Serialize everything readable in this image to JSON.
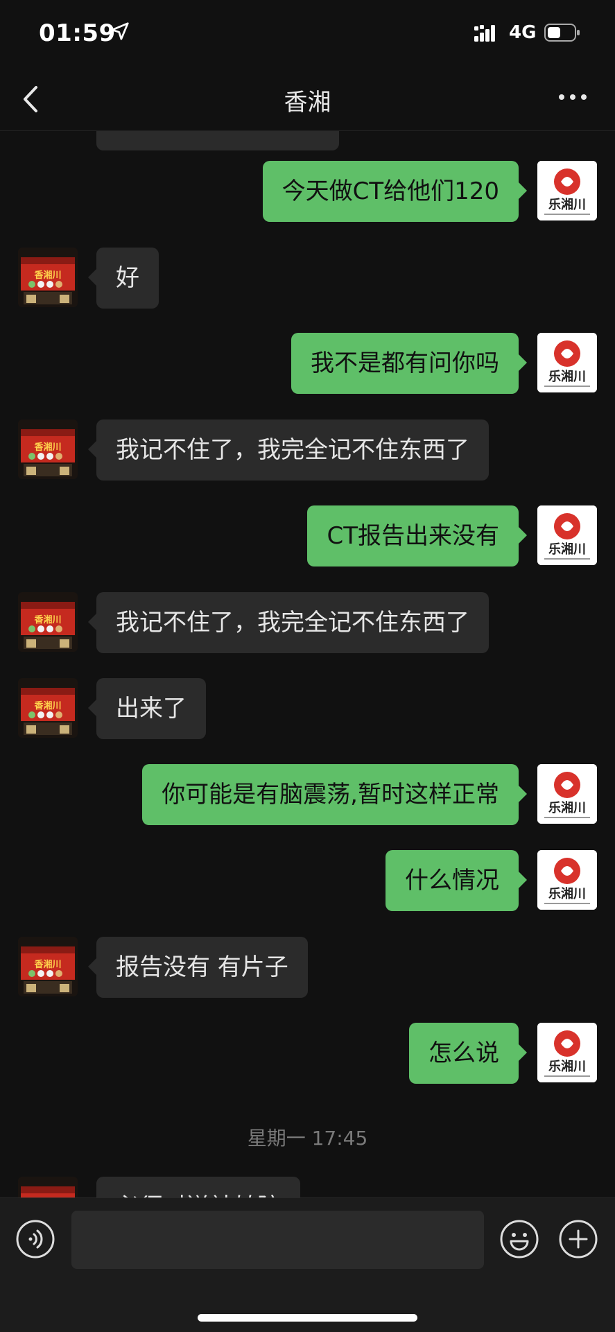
{
  "status_bar": {
    "time": "01:59",
    "network": "4G"
  },
  "nav": {
    "title": "香湘"
  },
  "messages": [
    {
      "side": "out",
      "text": "今天做CT给他们120"
    },
    {
      "side": "in",
      "text": "好"
    },
    {
      "side": "out",
      "text": "我不是都有问你吗"
    },
    {
      "side": "in",
      "text": "我记不住了，我完全记不住东西了"
    },
    {
      "side": "out",
      "text": "CT报告出来没有"
    },
    {
      "side": "in",
      "text": "我记不住了，我完全记不住东西了"
    },
    {
      "side": "in",
      "text": "出来了"
    },
    {
      "side": "out",
      "text": "你可能是有脑震荡,暂时这样正常"
    },
    {
      "side": "out",
      "text": "什么情况"
    },
    {
      "side": "in",
      "text": "报告没有 有片子"
    },
    {
      "side": "out",
      "text": "怎么说"
    },
    {
      "side": "in",
      "text": "必须对送社转院"
    }
  ],
  "timestamp": "星期一 17:45",
  "avatars": {
    "self_logo_text": "乐湘川",
    "contact_sign_text": "香湘川"
  },
  "colors": {
    "outgoing": "#5fbf68",
    "incoming": "#2b2b2b",
    "background": "#111111"
  }
}
